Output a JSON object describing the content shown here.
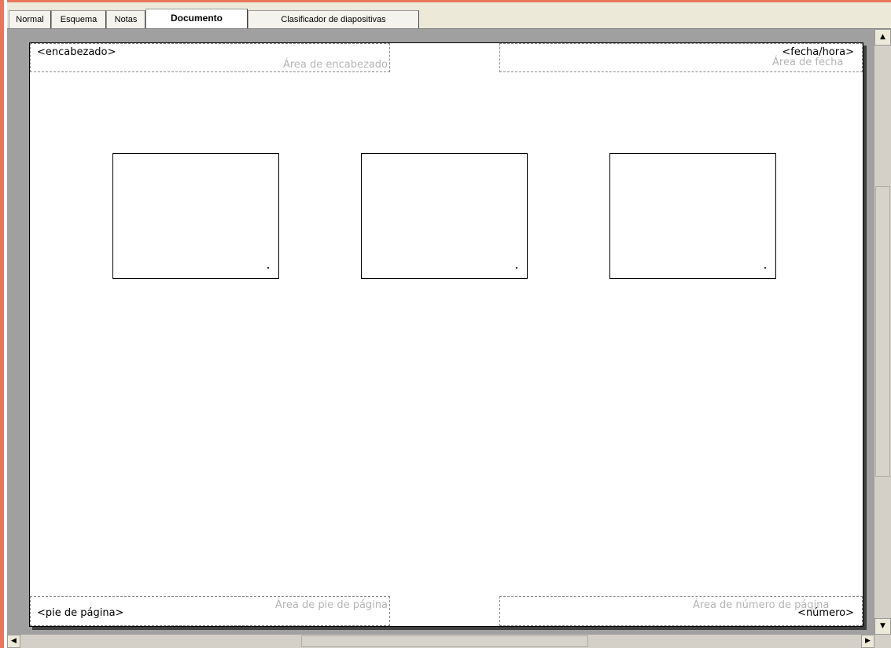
{
  "tabs": [
    {
      "label": "Normal",
      "active": false
    },
    {
      "label": "Esquema",
      "active": false
    },
    {
      "label": "Notas",
      "active": false
    },
    {
      "label": "Documento",
      "active": true
    },
    {
      "label": "Clasificador de diapositivas",
      "active": false
    }
  ],
  "page": {
    "header": {
      "field": "<encabezado>",
      "area_hint": "Área de encabezado"
    },
    "datetime": {
      "field": "<fecha/hora>",
      "area_hint": "Área de fecha"
    },
    "footer": {
      "field": "<pie de página>",
      "area_hint": "Área de pie de página"
    },
    "page_number": {
      "field": "<número>",
      "area_hint": "Área de número de página"
    },
    "slide_thumbnails": 3
  },
  "scrollbars": {
    "vertical": {
      "up_icon": "arrow-up-icon",
      "down_icon": "arrow-down-icon"
    },
    "horizontal": {
      "left_icon": "arrow-left-icon",
      "right_icon": "arrow-right-icon"
    }
  },
  "colors": {
    "frame_accent": "#e8765a",
    "workspace": "#a0a0a0",
    "tab_bar": "#ece9d8"
  }
}
